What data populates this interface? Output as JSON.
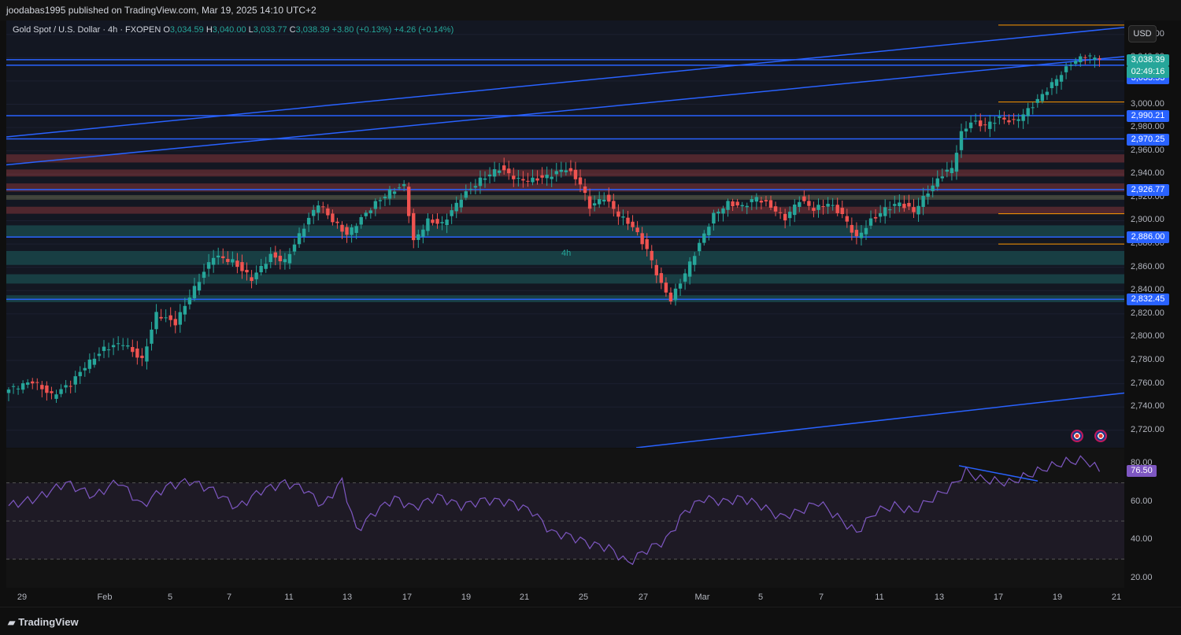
{
  "publisher_line": "joodabas1995 published on TradingView.com, Mar 19, 2025 14:10 UTC+2",
  "legend": {
    "symbol": "Gold Spot / U.S. Dollar · 4h · FXOPEN",
    "o_key": "O",
    "o": "3,034.59",
    "h_key": "H",
    "h": "3,040.00",
    "l_key": "L",
    "l": "3,033.77",
    "c_key": "C",
    "c": "3,038.39",
    "change": "+3.80 (+0.13%)",
    "change2": "+4.26 (+0.14%)"
  },
  "currency_button": "USD",
  "timeframe_label": "4h",
  "footer_brand": "TradingView",
  "colors": {
    "up": "#26a69a",
    "down": "#ef5350",
    "line": "#2962ff",
    "rsi": "#7e57c2",
    "orange": "#ff9800"
  },
  "price_axis_ticks": [
    "3,060.00",
    "3,040.00",
    "3,020.00",
    "3,000.00",
    "2,980.00",
    "2,960.00",
    "2,940.00",
    "2,920.00",
    "2,900.00",
    "2,880.00",
    "2,860.00",
    "2,840.00",
    "2,820.00",
    "2,800.00",
    "2,780.00",
    "2,760.00",
    "2,740.00",
    "2,720.00"
  ],
  "price_tags": [
    {
      "text": "3,038.39",
      "color": "#26a69a",
      "value": 3038.39
    },
    {
      "text": "3,038.25",
      "color": "#2962ff",
      "value": 3038.25
    },
    {
      "text": "3,033.53",
      "color": "#2962ff",
      "value": 3033.53
    },
    {
      "text": "2,990.21",
      "color": "#2962ff",
      "value": 2990.21
    },
    {
      "text": "2,970.25",
      "color": "#2962ff",
      "value": 2970.25
    },
    {
      "text": "2,926.77",
      "color": "#2962ff",
      "value": 2926.77
    },
    {
      "text": "2,886.00",
      "color": "#2962ff",
      "value": 2886.0
    },
    {
      "text": "2,832.45",
      "color": "#2962ff",
      "value": 2832.45
    }
  ],
  "countdown": "02:49:16",
  "rsi_axis_ticks": [
    "80.00",
    "60.00",
    "40.00",
    "20.00"
  ],
  "rsi_value_tag": "76.50",
  "time_axis_labels": [
    "29",
    "Feb",
    "5",
    "7",
    "11",
    "13",
    "17",
    "19",
    "21",
    "25",
    "27",
    "Mar",
    "5",
    "7",
    "11",
    "13",
    "17",
    "19",
    "21"
  ],
  "chart_data": {
    "type": "candlestick",
    "title": "Gold Spot / U.S. Dollar · 4h · FXOPEN",
    "ylim": [
      2705,
      3072
    ],
    "x_labels": [
      "29",
      "Feb",
      "5",
      "7",
      "11",
      "13",
      "17",
      "19",
      "21",
      "25",
      "27",
      "Mar",
      "5",
      "7",
      "11",
      "13",
      "17",
      "19",
      "21"
    ],
    "close_anchors": [
      {
        "i": 0,
        "c": 2755
      },
      {
        "i": 5,
        "c": 2762
      },
      {
        "i": 9,
        "c": 2750
      },
      {
        "i": 13,
        "c": 2760
      },
      {
        "i": 16,
        "c": 2775
      },
      {
        "i": 20,
        "c": 2790
      },
      {
        "i": 24,
        "c": 2795
      },
      {
        "i": 28,
        "c": 2780
      },
      {
        "i": 31,
        "c": 2820
      },
      {
        "i": 35,
        "c": 2812
      },
      {
        "i": 38,
        "c": 2835
      },
      {
        "i": 43,
        "c": 2870
      },
      {
        "i": 47,
        "c": 2865
      },
      {
        "i": 51,
        "c": 2850
      },
      {
        "i": 55,
        "c": 2870
      },
      {
        "i": 58,
        "c": 2865
      },
      {
        "i": 62,
        "c": 2895
      },
      {
        "i": 65,
        "c": 2915
      },
      {
        "i": 68,
        "c": 2900
      },
      {
        "i": 71,
        "c": 2888
      },
      {
        "i": 74,
        "c": 2902
      },
      {
        "i": 77,
        "c": 2915
      },
      {
        "i": 80,
        "c": 2925
      },
      {
        "i": 83,
        "c": 2930
      },
      {
        "i": 85,
        "c": 2882
      },
      {
        "i": 88,
        "c": 2900
      },
      {
        "i": 91,
        "c": 2897
      },
      {
        "i": 95,
        "c": 2920
      },
      {
        "i": 99,
        "c": 2935
      },
      {
        "i": 103,
        "c": 2945
      },
      {
        "i": 107,
        "c": 2935
      },
      {
        "i": 110,
        "c": 2935
      },
      {
        "i": 113,
        "c": 2938
      },
      {
        "i": 117,
        "c": 2945
      },
      {
        "i": 120,
        "c": 2932
      },
      {
        "i": 122,
        "c": 2912
      },
      {
        "i": 125,
        "c": 2920
      },
      {
        "i": 128,
        "c": 2905
      },
      {
        "i": 131,
        "c": 2895
      },
      {
        "i": 134,
        "c": 2875
      },
      {
        "i": 137,
        "c": 2845
      },
      {
        "i": 139,
        "c": 2832
      },
      {
        "i": 142,
        "c": 2855
      },
      {
        "i": 145,
        "c": 2880
      },
      {
        "i": 148,
        "c": 2905
      },
      {
        "i": 151,
        "c": 2915
      },
      {
        "i": 154,
        "c": 2912
      },
      {
        "i": 157,
        "c": 2920
      },
      {
        "i": 160,
        "c": 2912
      },
      {
        "i": 163,
        "c": 2902
      },
      {
        "i": 166,
        "c": 2918
      },
      {
        "i": 169,
        "c": 2910
      },
      {
        "i": 172,
        "c": 2915
      },
      {
        "i": 175,
        "c": 2905
      },
      {
        "i": 178,
        "c": 2885
      },
      {
        "i": 181,
        "c": 2900
      },
      {
        "i": 184,
        "c": 2910
      },
      {
        "i": 187,
        "c": 2915
      },
      {
        "i": 190,
        "c": 2908
      },
      {
        "i": 193,
        "c": 2925
      },
      {
        "i": 196,
        "c": 2940
      },
      {
        "i": 198,
        "c": 2945
      },
      {
        "i": 200,
        "c": 2975
      },
      {
        "i": 202,
        "c": 2985
      },
      {
        "i": 205,
        "c": 2982
      },
      {
        "i": 208,
        "c": 2988
      },
      {
        "i": 211,
        "c": 2985
      },
      {
        "i": 214,
        "c": 2995
      },
      {
        "i": 217,
        "c": 3008
      },
      {
        "i": 220,
        "c": 3022
      },
      {
        "i": 223,
        "c": 3035
      },
      {
        "i": 226,
        "c": 3042
      },
      {
        "i": 229,
        "c": 3038.39
      }
    ],
    "rsi": {
      "title": "RSI",
      "ylim": [
        15,
        88
      ],
      "levels": [
        70,
        50,
        30
      ],
      "last_value": 76.5,
      "anchors": [
        {
          "i": 0,
          "v": 58
        },
        {
          "i": 6,
          "v": 62
        },
        {
          "i": 12,
          "v": 70
        },
        {
          "i": 18,
          "v": 63
        },
        {
          "i": 23,
          "v": 71
        },
        {
          "i": 28,
          "v": 58
        },
        {
          "i": 33,
          "v": 68
        },
        {
          "i": 38,
          "v": 71
        },
        {
          "i": 43,
          "v": 66
        },
        {
          "i": 48,
          "v": 57
        },
        {
          "i": 53,
          "v": 66
        },
        {
          "i": 58,
          "v": 70
        },
        {
          "i": 62,
          "v": 67
        },
        {
          "i": 66,
          "v": 58
        },
        {
          "i": 70,
          "v": 71
        },
        {
          "i": 73,
          "v": 45
        },
        {
          "i": 77,
          "v": 55
        },
        {
          "i": 81,
          "v": 62
        },
        {
          "i": 85,
          "v": 57
        },
        {
          "i": 90,
          "v": 63
        },
        {
          "i": 95,
          "v": 58
        },
        {
          "i": 100,
          "v": 61
        },
        {
          "i": 105,
          "v": 60
        },
        {
          "i": 110,
          "v": 55
        },
        {
          "i": 114,
          "v": 44
        },
        {
          "i": 118,
          "v": 42
        },
        {
          "i": 122,
          "v": 38
        },
        {
          "i": 126,
          "v": 36
        },
        {
          "i": 130,
          "v": 28
        },
        {
          "i": 134,
          "v": 35
        },
        {
          "i": 138,
          "v": 40
        },
        {
          "i": 142,
          "v": 55
        },
        {
          "i": 146,
          "v": 62
        },
        {
          "i": 150,
          "v": 60
        },
        {
          "i": 154,
          "v": 62
        },
        {
          "i": 158,
          "v": 58
        },
        {
          "i": 162,
          "v": 52
        },
        {
          "i": 166,
          "v": 55
        },
        {
          "i": 170,
          "v": 60
        },
        {
          "i": 174,
          "v": 52
        },
        {
          "i": 178,
          "v": 44
        },
        {
          "i": 182,
          "v": 55
        },
        {
          "i": 186,
          "v": 58
        },
        {
          "i": 190,
          "v": 55
        },
        {
          "i": 194,
          "v": 62
        },
        {
          "i": 198,
          "v": 68
        },
        {
          "i": 201,
          "v": 76
        },
        {
          "i": 204,
          "v": 72
        },
        {
          "i": 207,
          "v": 71
        },
        {
          "i": 210,
          "v": 70
        },
        {
          "i": 214,
          "v": 74
        },
        {
          "i": 218,
          "v": 78
        },
        {
          "i": 222,
          "v": 81
        },
        {
          "i": 226,
          "v": 82
        },
        {
          "i": 229,
          "v": 76.5
        }
      ]
    },
    "horizontal_levels": [
      3038.25,
      3033.53,
      2990.21,
      2970.25,
      2926.77,
      2886.0,
      2832.45
    ],
    "zones": [
      {
        "from": 2950,
        "to": 2957,
        "type": "supply"
      },
      {
        "from": 2938,
        "to": 2944,
        "type": "supply"
      },
      {
        "from": 2925,
        "to": 2932,
        "type": "supply"
      },
      {
        "from": 2918,
        "to": 2922,
        "type": "neutral"
      },
      {
        "from": 2906,
        "to": 2912,
        "type": "supply"
      },
      {
        "from": 2886,
        "to": 2896,
        "type": "demand"
      },
      {
        "from": 2862,
        "to": 2874,
        "type": "demand"
      },
      {
        "from": 2846,
        "to": 2854,
        "type": "demand"
      },
      {
        "from": 2830,
        "to": 2836,
        "type": "demand"
      }
    ]
  }
}
